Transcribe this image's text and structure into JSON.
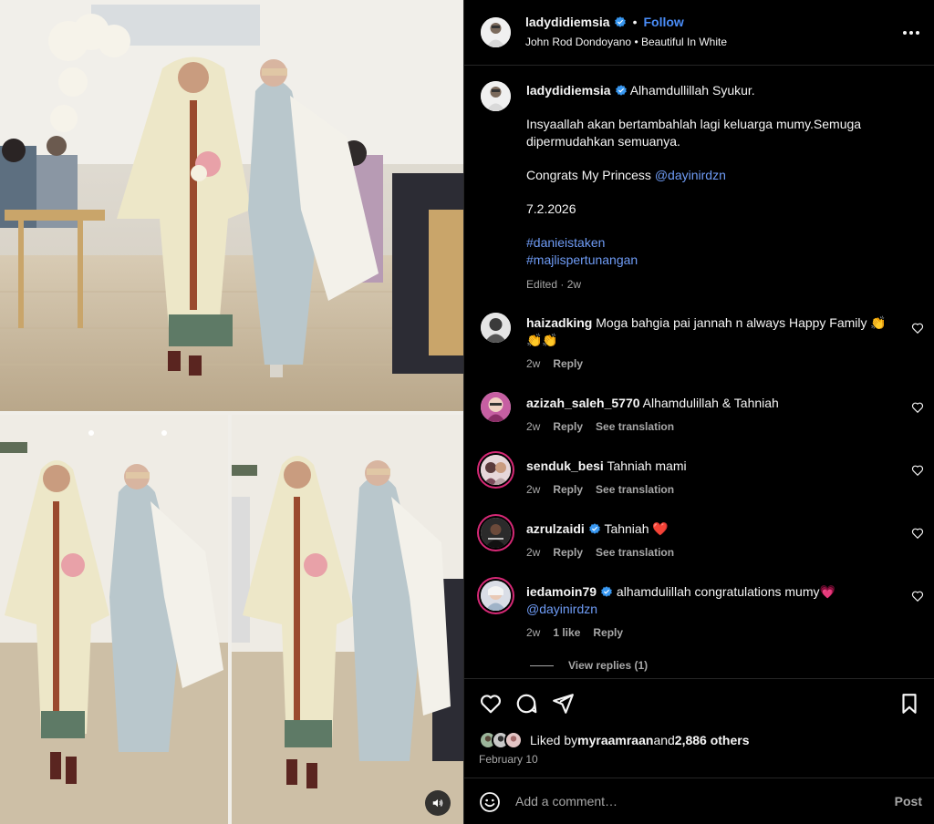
{
  "post": {
    "author": "ladydidiemsia",
    "follow_label": "Follow",
    "separator": "•",
    "audio_line_artist": "John Rod Dondoyano",
    "audio_line_song": "Beautiful In White"
  },
  "caption": {
    "author": "ladydidiemsia",
    "line1": "Alhamdullillah Syukur.",
    "line2": "Insyaallah akan bertambahlah lagi keluarga mumy.Semuga dipermudahkan semuanya.",
    "line3_prefix": "Congrats My Princess ",
    "line3_mention": "@dayinirdzn",
    "line4": "7.2.2026",
    "hashtag1": "#danieistaken",
    "hashtag2": "#majlispertunangan",
    "edited": "Edited · 2w"
  },
  "comments": [
    {
      "user": "haizadking",
      "text": "Moga bahgia pai jannah n always Happy Family 👏👏👏",
      "time": "2w",
      "reply": "Reply",
      "translate": ""
    },
    {
      "user": "azizah_saleh_5770",
      "text": "Alhamdulillah & Tahniah",
      "time": "2w",
      "reply": "Reply",
      "translate": "See translation"
    },
    {
      "user": "senduk_besi",
      "text": "Tahniah mami",
      "time": "2w",
      "reply": "Reply",
      "translate": "See translation"
    },
    {
      "user": "azrulzaidi",
      "text": "Tahniah ❤️",
      "time": "2w",
      "reply": "Reply",
      "translate": "See translation"
    },
    {
      "user": "iedamoin79",
      "text": "alhamdulillah congratulations mumy💗 ",
      "mention": "@dayinirdzn",
      "time": "2w",
      "likes": "1 like",
      "reply": "Reply"
    }
  ],
  "view_replies": "View replies (1)",
  "likes": {
    "prefix": "Liked by ",
    "user": "myraamraan",
    "middle": " and ",
    "count": "2,886 others"
  },
  "date": "February 10",
  "add_comment": {
    "placeholder": "Add a comment…",
    "post_label": "Post"
  },
  "colors": {
    "background": "#000000",
    "text": "#f5f5f5",
    "muted": "#a8a8a8",
    "link": "#6f9cf6",
    "follow": "#4a8df8",
    "verified": "#3897f0",
    "divider": "#262626"
  }
}
